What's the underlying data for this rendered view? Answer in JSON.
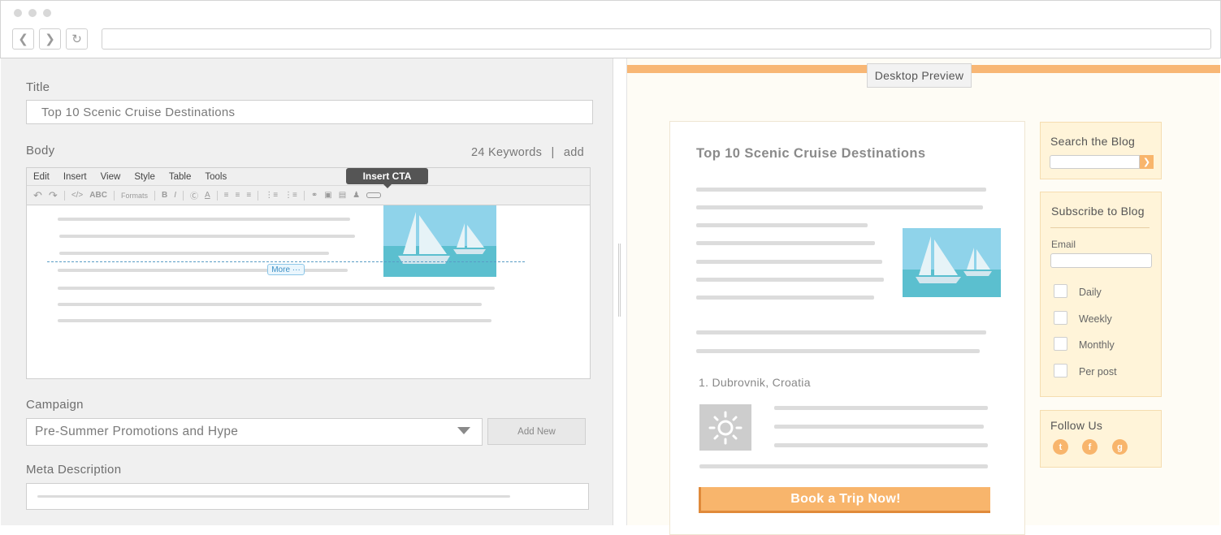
{
  "editor": {
    "title_label": "Title",
    "title_value": "Top 10 Scenic Cruise Destinations",
    "body_label": "Body",
    "keywords_count": "24 Keywords",
    "keywords_sep": "|",
    "keywords_add": "add",
    "menu": [
      "Edit",
      "Insert",
      "View",
      "Style",
      "Table",
      "Tools"
    ],
    "toolbar": {
      "abc": "ABC",
      "formats": "Formats",
      "bold": "B",
      "italic": "I"
    },
    "tooltip": "Insert CTA",
    "more_label": "More ···",
    "campaign_label": "Campaign",
    "campaign_value": "Pre-Summer Promotions and Hype",
    "add_new": "Add New",
    "meta_label": "Meta Description"
  },
  "preview": {
    "tab": "Desktop Preview",
    "article_title": "Top 10 Scenic Cruise Destinations",
    "list_item": "1. Dubrovnik, Croatia",
    "cta": "Book a Trip Now!",
    "search_title": "Search the Blog",
    "subscribe_title": "Subscribe to Blog",
    "email_label": "Email",
    "frequencies": [
      "Daily",
      "Weekly",
      "Monthly",
      "Per post"
    ],
    "follow_title": "Follow Us"
  },
  "colors": {
    "accent_orange": "#f8b775",
    "sky": "#8fd3ea",
    "sea": "#5bbfcf"
  },
  "icons": [
    "back-icon",
    "forward-icon",
    "reload-icon",
    "undo-icon",
    "redo-icon",
    "code-icon",
    "link-icon",
    "image-icon",
    "sun-icon",
    "twitter-icon",
    "facebook-icon",
    "googleplus-icon",
    "dropdown-arrow-icon",
    "search-go-icon"
  ]
}
